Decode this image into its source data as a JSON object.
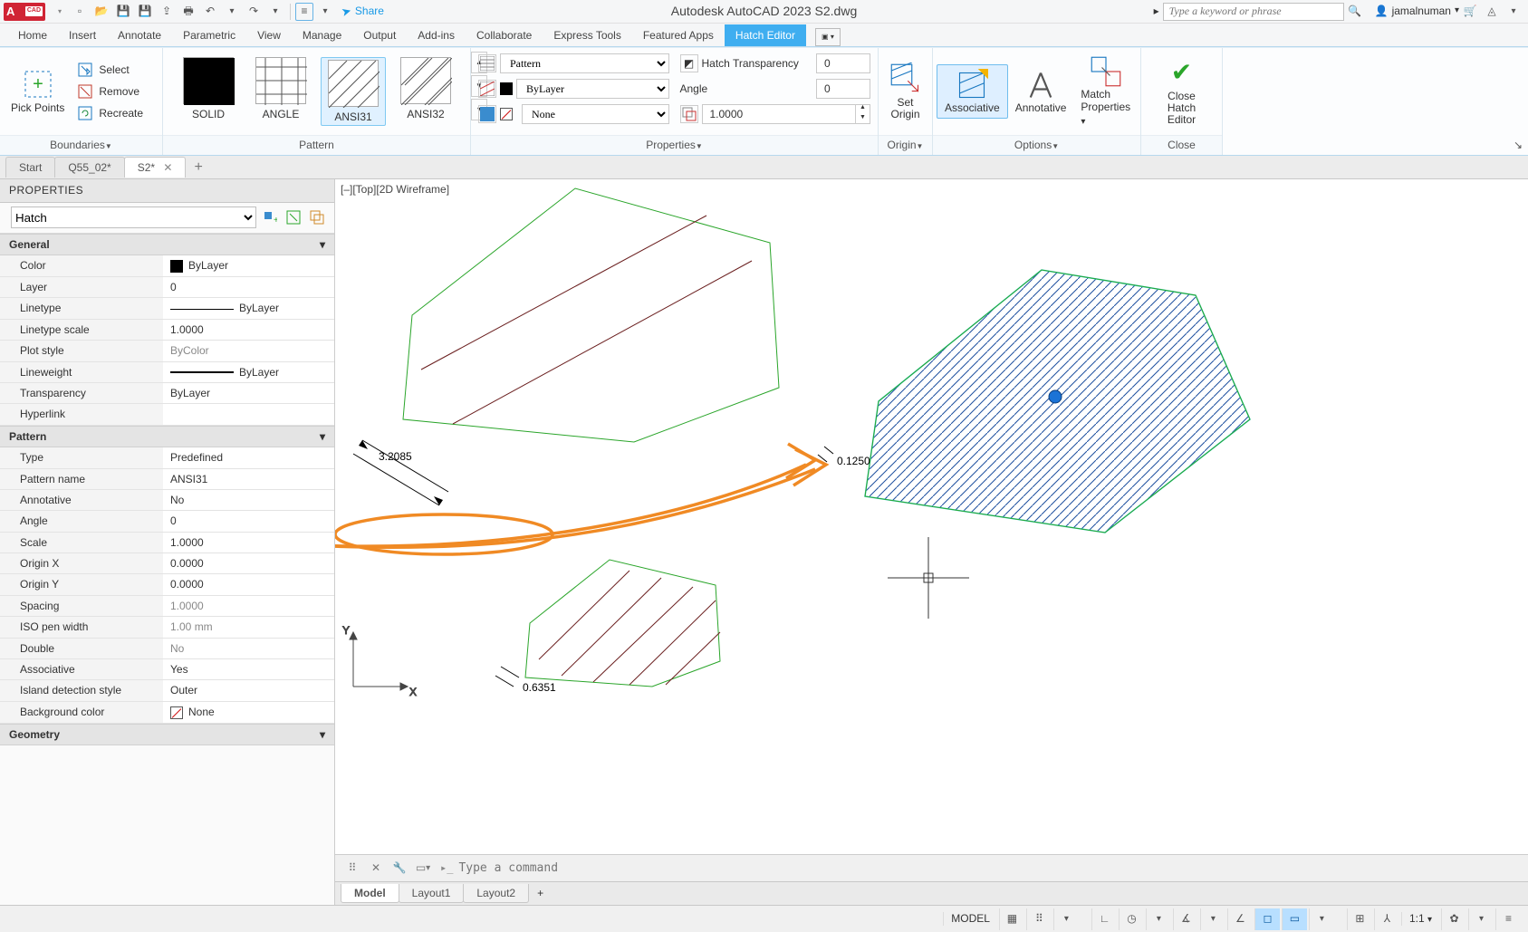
{
  "qat": {
    "logo_text": "A",
    "logo_sub": "CAD",
    "share": "Share",
    "title": "Autodesk AutoCAD 2023   S2.dwg",
    "search_placeholder": "Type a keyword or phrase",
    "user": "jamalnuman"
  },
  "menu": {
    "tabs": [
      "Home",
      "Insert",
      "Annotate",
      "Parametric",
      "View",
      "Manage",
      "Output",
      "Add-ins",
      "Collaborate",
      "Express Tools",
      "Featured Apps",
      "Hatch Editor"
    ],
    "active": 11
  },
  "ribbon": {
    "boundaries": {
      "pick_points": "Pick Points",
      "select": "Select",
      "remove": "Remove",
      "recreate": "Recreate",
      "label": "Boundaries"
    },
    "pattern": {
      "items": [
        "SOLID",
        "ANGLE",
        "ANSI31",
        "ANSI32"
      ],
      "active": 2,
      "label": "Pattern"
    },
    "properties": {
      "type_label": "Pattern",
      "color_label": "ByLayer",
      "none_label": "None",
      "transp_label": "Hatch Transparency",
      "transp_value": "0",
      "angle_label": "Angle",
      "angle_value": "0",
      "scale_value": "1.0000",
      "label": "Properties"
    },
    "origin": {
      "set_origin_l1": "Set",
      "set_origin_l2": "Origin",
      "label": "Origin"
    },
    "options": {
      "assoc": "Associative",
      "annot": "Annotative",
      "match_l1": "Match",
      "match_l2": "Properties",
      "label": "Options"
    },
    "close": {
      "l1": "Close",
      "l2": "Hatch Editor",
      "label": "Close"
    }
  },
  "filetabs": {
    "tabs": [
      "Start",
      "Q55_02*",
      "S2*"
    ],
    "active": 2
  },
  "props_panel": {
    "title": "PROPERTIES",
    "selector": "Hatch",
    "groups": {
      "general": {
        "title": "General",
        "rows": [
          {
            "k": "Color",
            "v": "ByLayer",
            "sw": true
          },
          {
            "k": "Layer",
            "v": "0"
          },
          {
            "k": "Linetype",
            "v": "ByLayer",
            "line": true
          },
          {
            "k": "Linetype scale",
            "v": "1.0000"
          },
          {
            "k": "Plot style",
            "v": "ByColor",
            "mut": true
          },
          {
            "k": "Lineweight",
            "v": "ByLayer",
            "thick": true
          },
          {
            "k": "Transparency",
            "v": "ByLayer"
          },
          {
            "k": "Hyperlink",
            "v": ""
          }
        ]
      },
      "pattern": {
        "title": "Pattern",
        "rows": [
          {
            "k": "Type",
            "v": "Predefined"
          },
          {
            "k": "Pattern name",
            "v": "ANSI31"
          },
          {
            "k": "Annotative",
            "v": "No"
          },
          {
            "k": "Angle",
            "v": "0"
          },
          {
            "k": "Scale",
            "v": "1.0000"
          },
          {
            "k": "Origin X",
            "v": "0.0000"
          },
          {
            "k": "Origin Y",
            "v": "0.0000"
          },
          {
            "k": "Spacing",
            "v": "1.0000",
            "mut": true
          },
          {
            "k": "ISO pen width",
            "v": "1.00 mm",
            "mut": true
          },
          {
            "k": "Double",
            "v": "No",
            "mut": true
          },
          {
            "k": "Associative",
            "v": "Yes"
          },
          {
            "k": "Island detection style",
            "v": "Outer"
          },
          {
            "k": "Background color",
            "v": "None",
            "none": true
          }
        ]
      },
      "geometry": {
        "title": "Geometry"
      }
    }
  },
  "canvas": {
    "view_label": "[–][Top][2D Wireframe]",
    "dims": [
      "3.2085",
      "0.6351",
      "0.1250"
    ]
  },
  "cmd": {
    "placeholder": "Type a command"
  },
  "layouttabs": {
    "tabs": [
      "Model",
      "Layout1",
      "Layout2"
    ],
    "active": 0
  },
  "status": {
    "model": "MODEL",
    "scale": "1:1"
  }
}
